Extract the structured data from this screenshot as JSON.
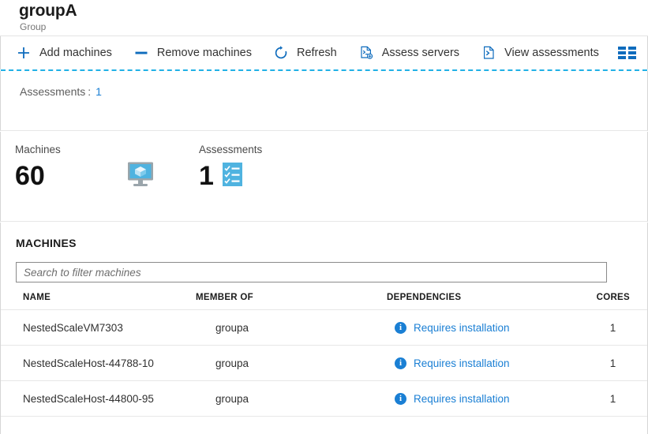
{
  "header": {
    "title": "groupA",
    "subtitle": "Group"
  },
  "toolbar": {
    "commands": [
      {
        "label": "Add machines",
        "icon": "plus-icon"
      },
      {
        "label": "Remove machines",
        "icon": "minus-icon"
      },
      {
        "label": "Refresh",
        "icon": "refresh-icon"
      },
      {
        "label": "Assess servers",
        "icon": "assess-servers-icon"
      },
      {
        "label": "View assessments",
        "icon": "view-assessments-icon"
      }
    ],
    "grid_toggle_icon": "grid-view-icon"
  },
  "facets": {
    "assessments_label": "Assessments",
    "separator": ":",
    "assessments_value": "1"
  },
  "stats": {
    "machines": {
      "label": "Machines",
      "value": "60",
      "icon": "monitor-box-icon"
    },
    "assessments": {
      "label": "Assessments",
      "value": "1",
      "icon": "checklist-icon"
    }
  },
  "machines_section": {
    "title": "MACHINES",
    "search": {
      "placeholder": "Search to filter machines",
      "value": ""
    },
    "columns": [
      "NAME",
      "MEMBER OF",
      "DEPENDENCIES",
      "CORES"
    ],
    "rows": [
      {
        "name": "NestedScaleVM7303",
        "member_of": "groupa",
        "dependencies": "Requires installation",
        "cores": "1"
      },
      {
        "name": "NestedScaleHost-44788-10",
        "member_of": "groupa",
        "dependencies": "Requires installation",
        "cores": "1"
      },
      {
        "name": "NestedScaleHost-44800-95",
        "member_of": "groupa",
        "dependencies": "Requires installation",
        "cores": "1"
      }
    ]
  },
  "colors": {
    "accent_blue": "#0f6cbd",
    "link_blue": "#1a7fd4",
    "dashed_cyan": "#21b1e6",
    "icon_light_blue": "#4fb3e0"
  }
}
